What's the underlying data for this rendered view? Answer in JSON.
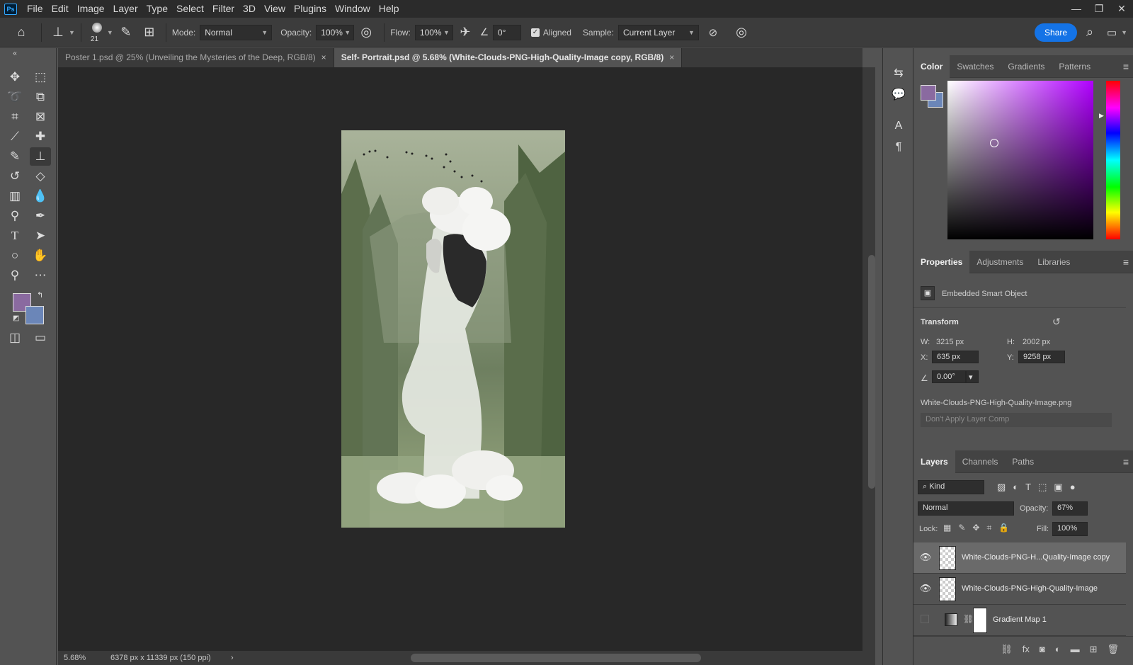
{
  "menubar": {
    "logo": "Ps",
    "items": [
      "File",
      "Edit",
      "Image",
      "Layer",
      "Type",
      "Select",
      "Filter",
      "3D",
      "View",
      "Plugins",
      "Window",
      "Help"
    ],
    "controls": [
      "—",
      "❐",
      "✕"
    ]
  },
  "options": {
    "brush_size": "21",
    "mode_label": "Mode:",
    "mode_value": "Normal",
    "opacity_label": "Opacity:",
    "opacity_value": "100%",
    "flow_label": "Flow:",
    "flow_value": "100%",
    "angle_value": "0°",
    "aligned_label": "Aligned",
    "sample_label": "Sample:",
    "sample_value": "Current Layer",
    "share_label": "Share"
  },
  "tabs": [
    {
      "label": "Poster 1.psd @ 25% (Unveiling the Mysteries of the Deep, RGB/8)",
      "close": "×"
    },
    {
      "label": "Self- Portrait.psd @ 5.68% (White-Clouds-PNG-High-Quality-Image copy, RGB/8)",
      "close": "×"
    }
  ],
  "status": {
    "zoom": "5.68%",
    "doc_info": "6378 px x 11339 px (150 ppi)",
    "arrow": "›"
  },
  "color_panel": {
    "tabs": [
      "Color",
      "Swatches",
      "Gradients",
      "Patterns"
    ],
    "foreground": "#8a6aa0",
    "background": "#6b86b8"
  },
  "properties_panel": {
    "tabs": [
      "Properties",
      "Adjustments",
      "Libraries"
    ],
    "object_type": "Embedded Smart Object",
    "transform_title": "Transform",
    "w_label": "W:",
    "w_value": "3215 px",
    "h_label": "H:",
    "h_value": "2002 px",
    "x_label": "X:",
    "x_value": "635 px",
    "y_label": "Y:",
    "y_value": "9258 px",
    "angle_value": "0.00°",
    "filename": "White-Clouds-PNG-High-Quality-Image.png",
    "layer_comp": "Don't Apply Layer Comp"
  },
  "layers_panel": {
    "tabs": [
      "Layers",
      "Channels",
      "Paths"
    ],
    "kind_label": "Kind",
    "blend_mode": "Normal",
    "opacity_label": "Opacity:",
    "opacity_value": "67%",
    "lock_label": "Lock:",
    "fill_label": "Fill:",
    "fill_value": "100%",
    "layers": [
      {
        "name": "White-Clouds-PNG-H...Quality-Image copy",
        "visible": true,
        "selected": true
      },
      {
        "name": "White-Clouds-PNG-High-Quality-Image",
        "visible": true,
        "selected": false
      },
      {
        "name": "Gradient Map 1",
        "visible": false,
        "selected": false
      }
    ]
  }
}
